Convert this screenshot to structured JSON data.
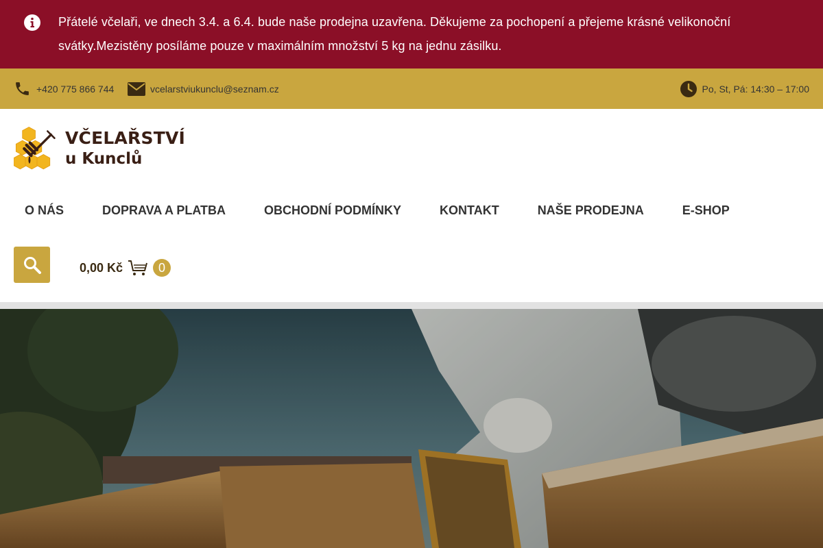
{
  "notice": {
    "icon": "info-icon",
    "text": "Přátelé včelaři, ve dnech 3.4. a 6.4. bude naše prodejna uzavřena. Děkujeme za pochopení a přejeme krásné velikonoční svátky.Mezistěny posíláme pouze v maximálním množství 5 kg na jednu zásilku.",
    "background": "#8b0f27"
  },
  "topbar": {
    "background": "#c9a63f",
    "phone": {
      "icon": "phone-icon",
      "text": "+420 775 866 744"
    },
    "email": {
      "icon": "envelope-icon",
      "text": "vcelarstviukunclu@seznam.cz"
    },
    "hours": {
      "icon": "clock-icon",
      "text": "Po, St, Pá: 14:30 – 17:00"
    }
  },
  "logo": {
    "icon": "honeycomb-honey-dipper-icon",
    "line1": "VČELAŘSTVÍ",
    "line2": "u Kunclů"
  },
  "nav": {
    "items": [
      {
        "label": "O NÁS"
      },
      {
        "label": "DOPRAVA A PLATBA"
      },
      {
        "label": "OBCHODNÍ PODMÍNKY"
      },
      {
        "label": "KONTAKT"
      },
      {
        "label": "NAŠE PRODEJNA"
      },
      {
        "label": "E-SHOP"
      }
    ]
  },
  "search": {
    "icon": "search-icon"
  },
  "cart": {
    "icon": "cart-icon",
    "total": "0,00 Kč",
    "count": "0"
  },
  "hero": {
    "image": "beekeeper-holding-honeycomb-frame-photo"
  },
  "colors": {
    "accent": "#c9a63f",
    "brand_dark": "#3a1f15",
    "notice_red": "#8b0f27"
  }
}
